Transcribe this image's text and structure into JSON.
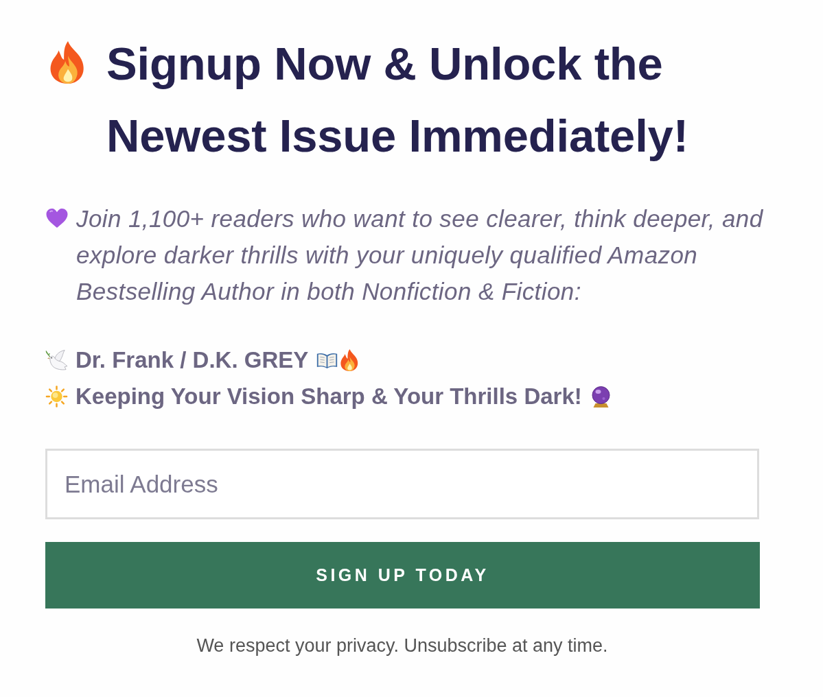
{
  "headline": {
    "text": "Signup Now & Unlock the Newest Issue Immediately!"
  },
  "intro": {
    "text": "Join 1,100+ readers who want to see clearer, think deeper, and explore darker thrills with your uniquely qualified Amazon Bestselling Author in both Nonfiction & Fiction:"
  },
  "taglines": [
    {
      "text": "Dr. Frank / D.K. GREY"
    },
    {
      "text": "Keeping Your Vision Sharp & Your Thrills Dark!"
    }
  ],
  "email_field": {
    "placeholder": "Email Address"
  },
  "submit_button": {
    "label": "SIGN UP TODAY"
  },
  "privacy_note": {
    "text": "We respect your privacy. Unsubscribe at any time."
  }
}
